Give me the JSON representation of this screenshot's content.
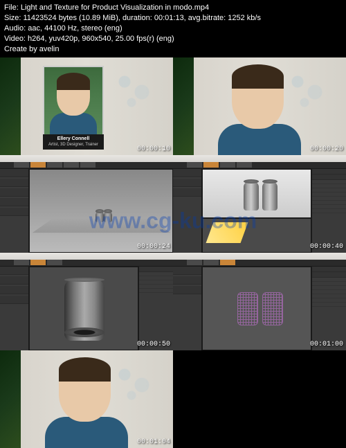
{
  "header": {
    "file": "File: Light and Texture for Product Visualization in modo.mp4",
    "size": "Size: 11423524 bytes (10.89 MiB), duration: 00:01:13, avg.bitrate: 1252 kb/s",
    "audio": "Audio: aac, 44100 Hz, stereo (eng)",
    "video": "Video: h264, yuv420p, 960x540, 25.00 fps(r) (eng)",
    "credit": "Create by avelin"
  },
  "caption": {
    "name": "Ellery Connell",
    "role": "Artist, 3D Designer, Trainer"
  },
  "thumbnails": [
    {
      "timecode": "00:00:10"
    },
    {
      "timecode": "00:00:20"
    },
    {
      "timecode": "00:00:24"
    },
    {
      "timecode": "00:00:40"
    },
    {
      "timecode": "00:00:50"
    },
    {
      "timecode": "00:01:00"
    },
    {
      "timecode": "00:01:04"
    }
  ],
  "watermark": "www.cg-ku.com"
}
